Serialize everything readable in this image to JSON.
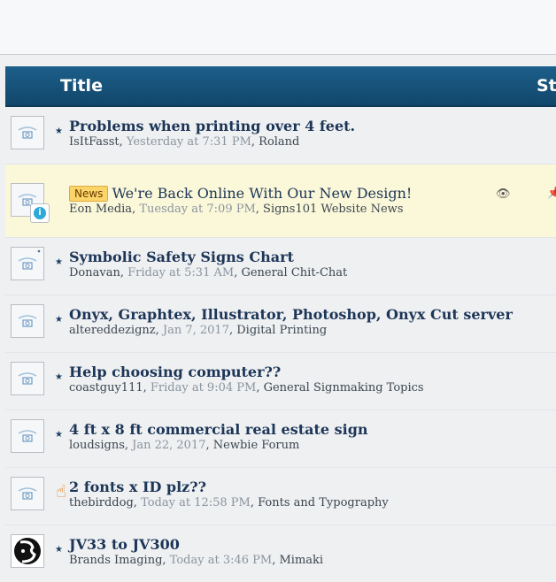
{
  "header": {
    "title": "Title",
    "stats": "Sta"
  },
  "threads": [
    {
      "title": "Problems when printing over 4 feet.",
      "author": "IsItFasst",
      "time": "Yesterday at 7:31 PM",
      "forum": "Roland",
      "avatar": "default"
    },
    {
      "prefix": "News",
      "title": "We're Back Online With Our New Design!",
      "author": "Eon Media",
      "time": "Tuesday at 7:09 PM",
      "forum": "Signs101 Website News",
      "avatar": "default",
      "sticky": true
    },
    {
      "title": "Symbolic Safety Signs Chart",
      "author": "Donavan",
      "time": "Friday at 5:31 AM",
      "forum": "General Chit-Chat",
      "avatar": "default"
    },
    {
      "title": "Onyx, Graphtex, Illustrator, Photoshop, Onyx Cut server",
      "author": "altereddezignz",
      "time": "Jan 7, 2017",
      "forum": "Digital Printing",
      "avatar": "default"
    },
    {
      "title": "Help choosing computer??",
      "author": "coastguy111",
      "time": "Friday at 9:04 PM",
      "forum": "General Signmaking Topics",
      "avatar": "default"
    },
    {
      "title": "4 ft x 8 ft commercial real estate sign",
      "author": "loudsigns",
      "time": "Jan 22, 2017",
      "forum": "Newbie Forum",
      "avatar": "default"
    },
    {
      "title": "2 fonts x ID plz??",
      "author": "thebirddog",
      "time": "Today at 12:58 PM",
      "forum": "Fonts and Typography",
      "avatar": "default"
    },
    {
      "title": "JV33 to JV300",
      "author": "Brands Imaging",
      "time": "Today at 3:46 PM",
      "forum": "Mimaki",
      "avatar": "custom"
    }
  ],
  "colors": {
    "header_bg": "#11466a",
    "sticky_bg": "#fbf8d9",
    "prefix_bg": "#fcd56a"
  }
}
